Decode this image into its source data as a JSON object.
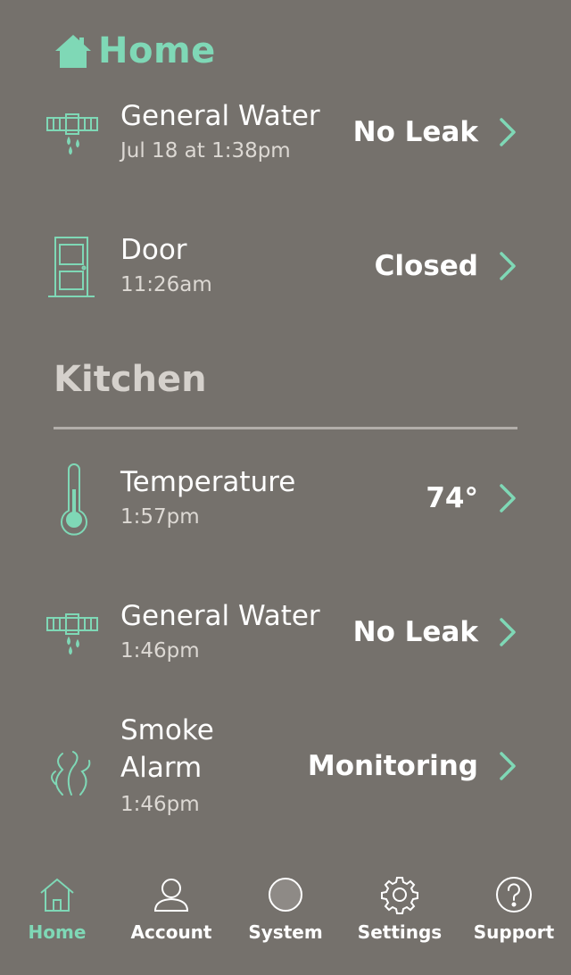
{
  "header": {
    "title": "Home",
    "icon": "house-icon"
  },
  "devices_home": [
    {
      "name": "General Water",
      "time": "Jul 18 at 1:38pm",
      "status": "No Leak",
      "icon": "water-leak-icon"
    },
    {
      "name": "Door",
      "time": "11:26am",
      "status": "Closed",
      "icon": "door-icon"
    }
  ],
  "section": {
    "title": "Kitchen"
  },
  "devices_kitchen": [
    {
      "name": "Temperature",
      "time": "1:57pm",
      "status": "74°",
      "icon": "thermometer-icon"
    },
    {
      "name": "General Water",
      "time": "1:46pm",
      "status": "No Leak",
      "icon": "water-leak-icon"
    },
    {
      "name": "Smoke\nAlarm",
      "time": "1:46pm",
      "status": "Monitoring",
      "icon": "smoke-icon"
    }
  ],
  "nav": {
    "items": [
      {
        "label": "Home",
        "icon": "home-nav-icon",
        "active": true
      },
      {
        "label": "Account",
        "icon": "account-icon"
      },
      {
        "label": "System",
        "icon": "system-icon"
      },
      {
        "label": "Settings",
        "icon": "gear-icon"
      },
      {
        "label": "Support",
        "icon": "question-icon"
      }
    ]
  },
  "colors": {
    "background": "#75716c",
    "accent": "#7fd8b6",
    "text": "#ffffff",
    "muted": "#ddd9d4"
  }
}
